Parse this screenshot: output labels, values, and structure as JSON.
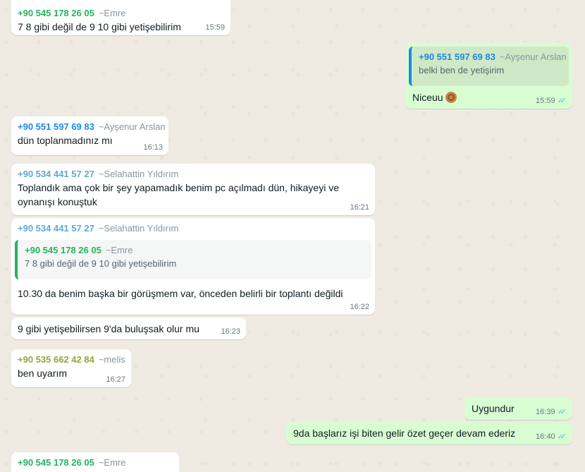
{
  "colors": {
    "chat_bg": "#efeae2",
    "bubble_in": "#ffffff",
    "bubble_out": "#d9fdd3",
    "timestamp": "#667781",
    "name_gray": "#8696a0",
    "read_ticks": "#53bdeb",
    "sender_emre": "#25b35e",
    "sender_aysenur": "#1e88e5",
    "sender_selahattin": "#5fa8d8",
    "sender_melis": "#8fa83b"
  },
  "messages": [
    {
      "sender_phone": "+90 545 178 26 05",
      "sender_name": "~Emre",
      "text": "7 8 gibi değil de 9 10 gibi yetişebilirim",
      "time": "15:59"
    },
    {
      "quote_phone": "+90 551 597 69 83",
      "quote_name": "~Ayşenur Arslan",
      "quote_text": "belki ben de yetişirim",
      "text": "Niceuu",
      "emoji": "ok-hand-emoji",
      "time": "15:59",
      "ticks": "✓✓"
    },
    {
      "sender_phone": "+90 551 597 69 83",
      "sender_name": "~Ayşenur Arslan",
      "text": "dün toplanmadınız mı",
      "time": "16:13"
    },
    {
      "sender_phone": "+90 534 441 57 27",
      "sender_name": "~Selahattin Yıldırım",
      "text_line1": "Toplandık ama çok bir şey yapamadık benim pc açılmadı dün, hikayeyi ve",
      "text_line2": "oynanışı konuştuk",
      "time": "16:21"
    },
    {
      "sender_phone": "+90 534 441 57 27",
      "sender_name": "~Selahattin Yıldırım",
      "quote_phone": "+90 545 178 26 05",
      "quote_name": "~Emre",
      "quote_text": "7 8 gibi değil de 9 10 gibi yetişebilirim",
      "text": "10.30 da benim başka bir görüşmem var, önceden belirli bir toplantı değildi",
      "time": "16:22"
    },
    {
      "text": "9 gibi yetişebilirsen 9'da buluşsak olur mu",
      "time": "16:23"
    },
    {
      "sender_phone": "+90 535 662 42 84",
      "sender_name": "~melis",
      "text": "ben uyarım",
      "time": "16:27"
    },
    {
      "text": "Uygundur",
      "time": "16:39",
      "ticks": "✓✓"
    },
    {
      "text": "9da başlarız işi biten gelir özet geçer devam ederiz",
      "time": "16:40",
      "ticks": "✓✓"
    },
    {
      "sender_phone": "+90 545 178 26 05",
      "sender_name": "~Emre"
    }
  ]
}
